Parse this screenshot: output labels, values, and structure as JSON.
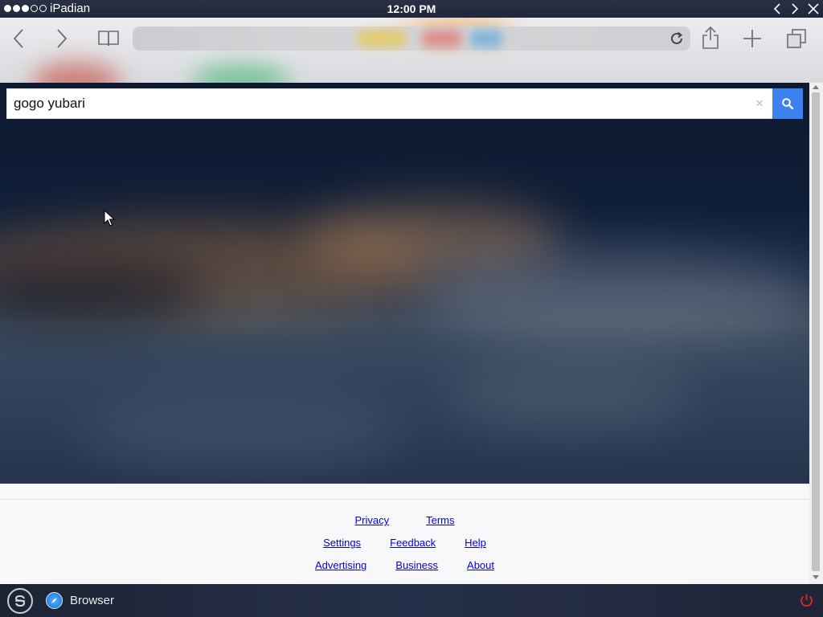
{
  "status_bar": {
    "carrier": "iPadian",
    "time": "12:00 PM",
    "signal_bars_filled": 3,
    "signal_bars_total": 5
  },
  "toolbar": {
    "back_icon": "chevron-left-icon",
    "forward_icon": "chevron-right-icon",
    "bookmarks_icon": "open-book-icon",
    "url": "",
    "reload_icon": "reload-icon",
    "share_icon": "share-icon",
    "new_tab_icon": "plus-icon",
    "tabs_icon": "tabs-icon"
  },
  "search": {
    "value": "gogo yubari",
    "clear_label": "×",
    "button_icon": "search-icon",
    "accent": "#3b82f0"
  },
  "footer": {
    "row1": [
      "Privacy",
      "Terms"
    ],
    "row2": [
      "Settings",
      "Feedback",
      "Help"
    ],
    "row3": [
      "Advertising",
      "Business",
      "About"
    ]
  },
  "taskbar": {
    "start_icon": "ipadian-logo-icon",
    "app_icon": "safari-compass-icon",
    "app_label": "Browser",
    "power_icon": "power-icon",
    "power_color": "#cc2a2a"
  }
}
